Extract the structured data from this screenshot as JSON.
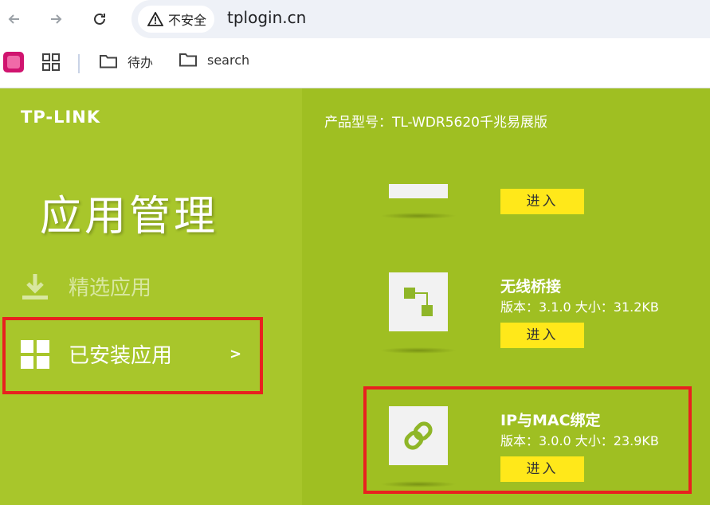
{
  "browser": {
    "security_label": "不安全",
    "url": "tplogin.cn"
  },
  "bookmarks": [
    {
      "label": "待办"
    },
    {
      "label": "search"
    }
  ],
  "sidebar": {
    "logo": "TP-LINK",
    "title": "应用管理",
    "menu": [
      {
        "label": "精选应用"
      },
      {
        "label": "已安装应用",
        "chevron": ">"
      }
    ]
  },
  "main": {
    "model_label": "产品型号：TL-WDR5620千兆易展版",
    "apps": [
      {
        "enter_label": "进入"
      },
      {
        "name": "无线桥接",
        "meta": "版本：3.1.0 大小：31.2KB",
        "enter_label": "进入"
      },
      {
        "name": "IP与MAC绑定",
        "meta": "版本：3.0.0 大小：23.9KB",
        "enter_label": "进入"
      }
    ]
  },
  "colors": {
    "sidebar_bg": "#a8c62b",
    "main_bg": "#9fbf22",
    "button_bg": "#ffe81a",
    "highlight": "#e8211f"
  }
}
